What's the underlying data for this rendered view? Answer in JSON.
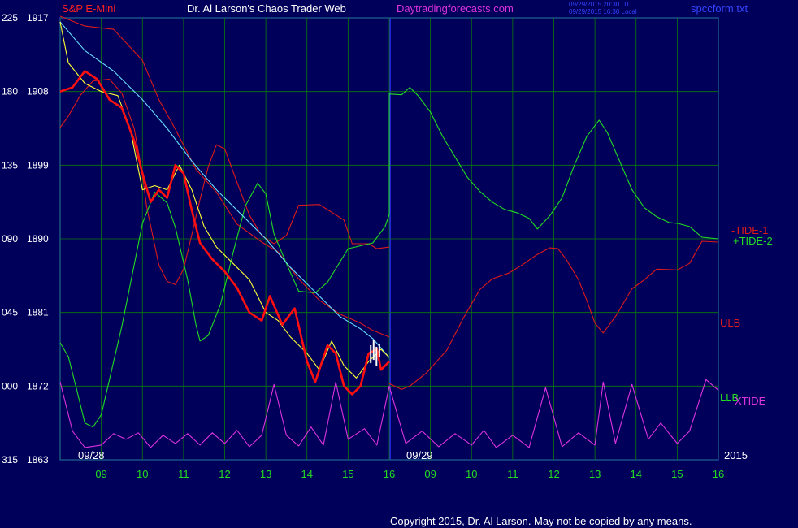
{
  "header": {
    "symbol": "S&P E-Mini",
    "site_name": "Dr. Al Larson's Chaos Trader Web",
    "site_url": "Daytradingforecasts.com",
    "ts_line1": "09/29/2015 20:30 UT",
    "ts_line2": "09/29/2015 16:30 Local",
    "file_name": "spccform.txt"
  },
  "footer": {
    "copyright": "Copyright 2015, Dr. Al Larson. May not be copied by any means."
  },
  "colors": {
    "background": "#00005a",
    "frame": "#2b2bff",
    "grid": "#0a7a0a",
    "price": "#ff1010",
    "white_bars": "#ffffff",
    "yellow": "#ffff33",
    "cyan": "#66ddff",
    "green": "#22dd22",
    "red": "#dd1a1a",
    "magenta": "#dd33dd",
    "label_green": "#22dd22",
    "label_white": "#ffffff"
  },
  "chart_data": {
    "type": "line",
    "y_ticks": [
      {
        "left": "225",
        "right": "1917",
        "value": 1917
      },
      {
        "left": "180",
        "right": "1908",
        "value": 1908
      },
      {
        "left": "135",
        "right": "1899",
        "value": 1899
      },
      {
        "left": "090",
        "right": "1890",
        "value": 1890
      },
      {
        "left": "045",
        "right": "1881",
        "value": 1881
      },
      {
        "left": "000",
        "right": "1872",
        "value": 1872
      },
      {
        "left": "315",
        "right": "1863",
        "value": 1863
      }
    ],
    "ylim": [
      1863,
      1917
    ],
    "x_ticks": [
      "09",
      "10",
      "11",
      "12",
      "13",
      "14",
      "15",
      "16",
      "09",
      "10",
      "11",
      "12",
      "13",
      "14",
      "15",
      "16"
    ],
    "date_labels": [
      "09/28",
      "09/29"
    ],
    "year_label": "2015",
    "series_labels": [
      {
        "text": "-TIDE-1",
        "color": "#dd1a1a"
      },
      {
        "text": "+TIDE-2",
        "color": "#22dd22"
      },
      {
        "text": "ULB",
        "color": "#dd1a1a"
      },
      {
        "text": "LLB",
        "color": "#22dd22"
      },
      {
        "text": "XTIDE",
        "color": "#dd33dd"
      }
    ],
    "grid": true,
    "series": [
      {
        "name": "red_upper",
        "color": "#dd1a1a",
        "points": [
          [
            8.0,
            1917.2
          ],
          [
            8.6,
            1916.0
          ],
          [
            9.3,
            1915.6
          ],
          [
            10.0,
            1911.8
          ],
          [
            10.4,
            1907.0
          ],
          [
            10.8,
            1903.4
          ],
          [
            11.3,
            1898.5
          ],
          [
            11.8,
            1895.7
          ],
          [
            12.3,
            1891.8
          ],
          [
            12.9,
            1889.6
          ],
          [
            13.3,
            1888.4
          ],
          [
            13.8,
            1885.1
          ],
          [
            14.3,
            1882.5
          ],
          [
            14.8,
            1880.8
          ],
          [
            15.3,
            1879.7
          ],
          [
            15.6,
            1878.8
          ],
          [
            16.0,
            1878.0
          ]
        ]
      },
      {
        "name": "red_osc",
        "color": "#dd1a1a",
        "points": [
          [
            8.0,
            1903.6
          ],
          [
            8.2,
            1905.0
          ],
          [
            8.5,
            1907.6
          ],
          [
            8.8,
            1909.3
          ],
          [
            9.2,
            1909.5
          ],
          [
            9.5,
            1907.8
          ],
          [
            9.8,
            1903.5
          ],
          [
            10.0,
            1897.9
          ],
          [
            10.1,
            1894.0
          ],
          [
            10.4,
            1886.8
          ],
          [
            10.6,
            1884.8
          ],
          [
            10.8,
            1884.4
          ],
          [
            11.0,
            1886.3
          ],
          [
            11.2,
            1890.5
          ],
          [
            11.4,
            1894.8
          ],
          [
            11.6,
            1898.8
          ],
          [
            11.8,
            1901.5
          ],
          [
            12.0,
            1901.0
          ],
          [
            12.3,
            1896.9
          ],
          [
            12.6,
            1892.9
          ],
          [
            12.9,
            1890.4
          ],
          [
            13.2,
            1889.4
          ],
          [
            13.5,
            1890.4
          ],
          [
            13.8,
            1894.1
          ],
          [
            14.3,
            1894.2
          ],
          [
            14.9,
            1892.3
          ],
          [
            15.1,
            1889.4
          ],
          [
            15.5,
            1889.4
          ],
          [
            15.7,
            1888.8
          ],
          [
            16.0,
            1889.0
          ]
        ]
      },
      {
        "name": "red_tide",
        "color": "#dd1a1a",
        "points": [
          [
            16.0,
            1872.3
          ],
          [
            16.3,
            1871.6
          ],
          [
            16.5,
            1872.0
          ],
          [
            16.9,
            1873.6
          ],
          [
            17.4,
            1876.4
          ],
          [
            17.8,
            1880.3
          ],
          [
            18.2,
            1883.8
          ],
          [
            18.5,
            1885.1
          ],
          [
            18.9,
            1885.8
          ],
          [
            19.2,
            1886.7
          ],
          [
            19.4,
            1887.4
          ],
          [
            19.6,
            1888.1
          ],
          [
            19.9,
            1888.9
          ],
          [
            20.1,
            1888.8
          ],
          [
            20.3,
            1887.5
          ],
          [
            20.6,
            1885.0
          ],
          [
            20.8,
            1882.5
          ],
          [
            21.0,
            1879.7
          ],
          [
            21.2,
            1878.5
          ],
          [
            21.5,
            1880.5
          ],
          [
            21.9,
            1883.9
          ],
          [
            22.2,
            1885.0
          ],
          [
            22.5,
            1886.3
          ],
          [
            23.0,
            1886.2
          ],
          [
            23.3,
            1887.0
          ],
          [
            23.6,
            1889.7
          ],
          [
            24.0,
            1889.6
          ]
        ]
      },
      {
        "name": "green",
        "color": "#22dd22",
        "points": [
          [
            8.0,
            1877.3
          ],
          [
            8.2,
            1875.6
          ],
          [
            8.4,
            1871.6
          ],
          [
            8.6,
            1867.5
          ],
          [
            8.8,
            1867.0
          ],
          [
            9.0,
            1868.5
          ],
          [
            9.2,
            1872.8
          ],
          [
            9.5,
            1879.3
          ],
          [
            9.8,
            1886.8
          ],
          [
            10.0,
            1891.9
          ],
          [
            10.3,
            1895.7
          ],
          [
            10.6,
            1894.4
          ],
          [
            10.8,
            1891.4
          ],
          [
            11.1,
            1885.0
          ],
          [
            11.3,
            1879.5
          ],
          [
            11.4,
            1877.5
          ],
          [
            11.6,
            1878.2
          ],
          [
            11.9,
            1882.0
          ],
          [
            12.2,
            1888.2
          ],
          [
            12.5,
            1894.0
          ],
          [
            12.8,
            1896.8
          ],
          [
            13.0,
            1895.5
          ],
          [
            13.2,
            1890.6
          ],
          [
            13.5,
            1887.0
          ],
          [
            13.8,
            1883.6
          ],
          [
            14.2,
            1883.4
          ],
          [
            14.5,
            1884.7
          ],
          [
            15.0,
            1888.8
          ],
          [
            15.6,
            1889.5
          ],
          [
            15.9,
            1891.5
          ],
          [
            16.0,
            1893.0
          ],
          [
            16.0,
            1907.7
          ],
          [
            16.3,
            1907.6
          ],
          [
            16.5,
            1908.5
          ],
          [
            16.7,
            1907.5
          ],
          [
            17.0,
            1905.5
          ],
          [
            17.3,
            1902.5
          ],
          [
            17.6,
            1900.0
          ],
          [
            17.9,
            1897.5
          ],
          [
            18.2,
            1895.8
          ],
          [
            18.5,
            1894.5
          ],
          [
            18.8,
            1893.6
          ],
          [
            19.1,
            1893.2
          ],
          [
            19.4,
            1892.5
          ],
          [
            19.6,
            1891.2
          ],
          [
            19.9,
            1892.8
          ],
          [
            20.2,
            1895.0
          ],
          [
            20.5,
            1899.0
          ],
          [
            20.8,
            1902.5
          ],
          [
            21.1,
            1904.5
          ],
          [
            21.3,
            1903.0
          ],
          [
            21.6,
            1899.5
          ],
          [
            21.9,
            1896.0
          ],
          [
            22.2,
            1893.8
          ],
          [
            22.5,
            1892.7
          ],
          [
            22.8,
            1892.0
          ],
          [
            23.0,
            1891.9
          ],
          [
            23.3,
            1891.5
          ],
          [
            23.6,
            1890.2
          ],
          [
            24.0,
            1890.0
          ]
        ]
      },
      {
        "name": "cyan",
        "color": "#66ddff",
        "points": [
          [
            8.0,
            1916.5
          ],
          [
            8.6,
            1913.0
          ],
          [
            9.3,
            1910.5
          ],
          [
            10.0,
            1907.0
          ],
          [
            10.6,
            1903.5
          ],
          [
            11.2,
            1899.5
          ],
          [
            11.8,
            1896.0
          ],
          [
            12.4,
            1893.0
          ],
          [
            13.0,
            1890.0
          ],
          [
            13.6,
            1886.5
          ],
          [
            14.2,
            1883.5
          ],
          [
            14.8,
            1880.5
          ],
          [
            15.3,
            1879.0
          ],
          [
            15.6,
            1877.8
          ],
          [
            16.0,
            1875.5
          ]
        ]
      },
      {
        "name": "yellow",
        "color": "#ffff33",
        "points": [
          [
            8.0,
            1916.5
          ],
          [
            8.2,
            1911.5
          ],
          [
            8.6,
            1909.0
          ],
          [
            9.0,
            1908.0
          ],
          [
            9.4,
            1907.5
          ],
          [
            9.7,
            1903.5
          ],
          [
            10.0,
            1896.0
          ],
          [
            10.3,
            1896.5
          ],
          [
            10.6,
            1896.0
          ],
          [
            10.9,
            1899.0
          ],
          [
            11.2,
            1896.0
          ],
          [
            11.5,
            1891.5
          ],
          [
            11.8,
            1889.0
          ],
          [
            12.2,
            1887.0
          ],
          [
            12.6,
            1885.0
          ],
          [
            13.0,
            1881.0
          ],
          [
            13.3,
            1880.0
          ],
          [
            13.6,
            1878.0
          ],
          [
            14.0,
            1876.0
          ],
          [
            14.3,
            1874.0
          ],
          [
            14.6,
            1877.5
          ],
          [
            14.9,
            1874.5
          ],
          [
            15.2,
            1873.0
          ],
          [
            15.5,
            1875.0
          ],
          [
            15.8,
            1876.5
          ],
          [
            16.0,
            1875.5
          ]
        ]
      },
      {
        "name": "price",
        "color": "#ff1010",
        "points": [
          [
            8.0,
            1908.0
          ],
          [
            8.3,
            1908.5
          ],
          [
            8.6,
            1910.5
          ],
          [
            8.9,
            1909.5
          ],
          [
            9.2,
            1907.0
          ],
          [
            9.5,
            1906.0
          ],
          [
            9.8,
            1902.0
          ],
          [
            10.0,
            1898.0
          ],
          [
            10.2,
            1894.5
          ],
          [
            10.4,
            1896.0
          ],
          [
            10.6,
            1895.0
          ],
          [
            10.8,
            1899.0
          ],
          [
            11.0,
            1898.0
          ],
          [
            11.2,
            1893.5
          ],
          [
            11.4,
            1889.5
          ],
          [
            11.7,
            1887.5
          ],
          [
            12.0,
            1886.0
          ],
          [
            12.3,
            1884.0
          ],
          [
            12.6,
            1881.0
          ],
          [
            12.9,
            1880.0
          ],
          [
            13.1,
            1883.0
          ],
          [
            13.4,
            1879.5
          ],
          [
            13.7,
            1881.5
          ],
          [
            14.0,
            1875.0
          ],
          [
            14.2,
            1872.5
          ],
          [
            14.5,
            1877.0
          ],
          [
            14.7,
            1876.0
          ],
          [
            14.9,
            1872.0
          ],
          [
            15.1,
            1871.0
          ],
          [
            15.3,
            1872.0
          ],
          [
            15.5,
            1876.0
          ],
          [
            15.7,
            1876.5
          ],
          [
            15.8,
            1874.0
          ],
          [
            16.0,
            1875.0
          ]
        ]
      },
      {
        "name": "magenta",
        "color": "#dd33dd",
        "points": [
          [
            8.0,
            1872.5
          ],
          [
            8.3,
            1866.5
          ],
          [
            8.6,
            1864.5
          ],
          [
            9.0,
            1864.8
          ],
          [
            9.3,
            1866.2
          ],
          [
            9.6,
            1865.5
          ],
          [
            9.9,
            1866.3
          ],
          [
            10.2,
            1864.5
          ],
          [
            10.5,
            1866.0
          ],
          [
            10.8,
            1865.0
          ],
          [
            11.1,
            1866.2
          ],
          [
            11.4,
            1864.8
          ],
          [
            11.7,
            1866.3
          ],
          [
            12.0,
            1865.0
          ],
          [
            12.3,
            1866.6
          ],
          [
            12.6,
            1864.6
          ],
          [
            12.9,
            1866.0
          ],
          [
            13.2,
            1872.2
          ],
          [
            13.5,
            1866.0
          ],
          [
            13.8,
            1864.7
          ],
          [
            14.1,
            1867.0
          ],
          [
            14.4,
            1864.8
          ],
          [
            14.7,
            1872.5
          ],
          [
            15.0,
            1865.5
          ],
          [
            15.4,
            1866.8
          ],
          [
            15.7,
            1864.8
          ],
          [
            16.0,
            1872.0
          ],
          [
            16.4,
            1865.0
          ],
          [
            16.8,
            1866.5
          ],
          [
            17.2,
            1864.6
          ],
          [
            17.6,
            1866.2
          ],
          [
            18.0,
            1864.8
          ],
          [
            18.3,
            1866.6
          ],
          [
            18.6,
            1864.5
          ],
          [
            19.0,
            1866.0
          ],
          [
            19.4,
            1864.5
          ],
          [
            19.8,
            1871.8
          ],
          [
            20.2,
            1864.6
          ],
          [
            20.6,
            1866.3
          ],
          [
            21.0,
            1864.8
          ],
          [
            21.2,
            1872.5
          ],
          [
            21.5,
            1865.0
          ],
          [
            21.9,
            1872.2
          ],
          [
            22.3,
            1865.5
          ],
          [
            22.6,
            1867.5
          ],
          [
            23.0,
            1865.0
          ],
          [
            23.3,
            1866.5
          ],
          [
            23.7,
            1872.8
          ],
          [
            24.0,
            1871.5
          ]
        ]
      }
    ]
  }
}
